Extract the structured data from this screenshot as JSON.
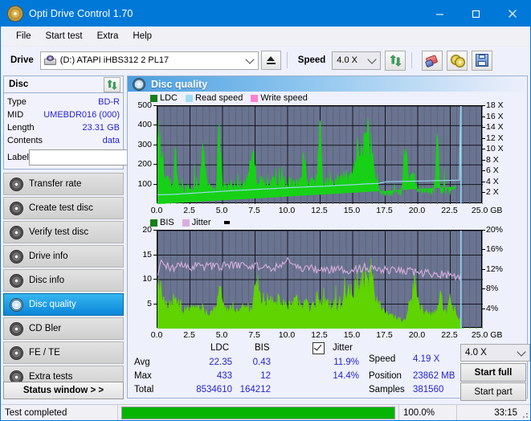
{
  "window": {
    "title": "Opti Drive Control 1.70",
    "icon": "disc-icon",
    "minimize": "–",
    "maximize": "□",
    "close": "✕"
  },
  "menu": [
    "File",
    "Start test",
    "Extra",
    "Help"
  ],
  "toolbar": {
    "drive_label": "Drive",
    "drive_value": "(D:)   ATAPI iHBS312   2 PL17",
    "eject_title": "Eject",
    "speed_label": "Speed",
    "speed_value": "4.0 X",
    "buttons": [
      "refresh-icon",
      "eraser-icon",
      "discs-icon",
      "save-icon"
    ]
  },
  "disc_panel": {
    "title": "Disc",
    "refresh_icon": "refresh-icon",
    "rows": [
      {
        "key": "Type",
        "value": "BD-R"
      },
      {
        "key": "MID",
        "value": "UMEBDR016 (000)"
      },
      {
        "key": "Length",
        "value": "23.31 GB"
      },
      {
        "key": "Contents",
        "value": "data"
      }
    ],
    "label_key": "Label",
    "label_value": "",
    "label_placeholder": ""
  },
  "nav": {
    "items": [
      {
        "label": "Transfer rate",
        "selected": false
      },
      {
        "label": "Create test disc",
        "selected": false
      },
      {
        "label": "Verify test disc",
        "selected": false
      },
      {
        "label": "Drive info",
        "selected": false
      },
      {
        "label": "Disc info",
        "selected": false
      },
      {
        "label": "Disc quality",
        "selected": true
      },
      {
        "label": "CD Bler",
        "selected": false
      },
      {
        "label": "FE / TE",
        "selected": false
      },
      {
        "label": "Extra tests",
        "selected": false
      }
    ],
    "status_window": "Status window > >"
  },
  "panel": {
    "title": "Disc quality",
    "icon": "disc-quality-icon"
  },
  "stats": {
    "col_ldc": "LDC",
    "col_bis": "BIS",
    "col_jitter": "Jitter",
    "row_avg": "Avg",
    "row_max": "Max",
    "row_total": "Total",
    "ldc_avg": "22.35",
    "ldc_max": "433",
    "ldc_total": "8534610",
    "bis_avg": "0.43",
    "bis_max": "12",
    "bis_total": "164212",
    "jitter_checked": true,
    "jitter_avg": "11.9%",
    "jitter_max": "14.4%",
    "speed_label": "Speed",
    "speed_value": "4.19 X",
    "position_label": "Position",
    "position_value": "23862 MB",
    "samples_label": "Samples",
    "samples_value": "381560",
    "speed_select": "4.0 X",
    "start_full": "Start full",
    "start_part": "Start part"
  },
  "statusbar": {
    "message": "Test completed",
    "percent_text": "100.0%",
    "percent_value": 100,
    "elapsed": "33:15"
  },
  "colors": {
    "accent": "#0078d7",
    "ldc_green": "#17d117",
    "bis_green": "#5fd400",
    "read_speed": "#9fdcf5",
    "write_speed": "#ff7fd4",
    "jitter_pink": "#d9aede",
    "plot_bg": "#6a7490",
    "value_blue": "#2424cc",
    "progress_green": "#06b406"
  },
  "chart_data": [
    {
      "type": "area",
      "name": "disc-quality-ldc",
      "title": "",
      "xlabel": "GB",
      "ylabel": "",
      "xlim": [
        0,
        25
      ],
      "ylim": [
        0,
        500
      ],
      "y2lim": [
        0,
        18
      ],
      "xticks": [
        "0.0",
        "2.5",
        "5.0",
        "7.5",
        "10.0",
        "12.5",
        "15.0",
        "17.5",
        "20.0",
        "22.5",
        "25.0"
      ],
      "xtick_suffix": "GB",
      "yticks": [
        100,
        200,
        300,
        400,
        500
      ],
      "y2ticks": [
        "2 X",
        "4 X",
        "6 X",
        "8 X",
        "10 X",
        "12 X",
        "14 X",
        "16 X",
        "18 X"
      ],
      "grid": true,
      "legend": [
        {
          "label": "LDC",
          "color": "#178017"
        },
        {
          "label": "Read speed",
          "color": "#9fdcf5"
        },
        {
          "label": "Write speed",
          "color": "#ff7fd4"
        }
      ],
      "legend_position": "top-left",
      "series": [
        {
          "name": "LDC",
          "color": "#17d117",
          "x": [
            0.0,
            0.12,
            0.25,
            0.37,
            0.5,
            0.62,
            0.75,
            0.87,
            1.0,
            1.12,
            1.25,
            1.37,
            1.5,
            1.62,
            1.75,
            1.87,
            2.0,
            2.25,
            2.5,
            2.75,
            3.0,
            3.25,
            3.5,
            3.75,
            3.85,
            4.0,
            4.25,
            4.5,
            4.75,
            5.0,
            5.15,
            5.3,
            5.5,
            5.75,
            6.0,
            6.25,
            6.5,
            6.75,
            7.0,
            7.25,
            7.5,
            7.6,
            7.75,
            7.9,
            8.0,
            8.25,
            8.5,
            8.75,
            9.0,
            9.25,
            9.5,
            9.75,
            10.0,
            10.25,
            10.5,
            10.75,
            11.0,
            11.25,
            11.5,
            11.75,
            12.0,
            12.25,
            12.5,
            12.6,
            12.7,
            12.9,
            13.0,
            13.25,
            13.5,
            13.75,
            14.0,
            14.25,
            14.5,
            14.75,
            15.0,
            15.25,
            15.5,
            15.7,
            15.85,
            16.0,
            16.15,
            16.3,
            16.5,
            16.75,
            17.0,
            17.25,
            17.5,
            17.75,
            18.0,
            18.25,
            18.5,
            18.75,
            19.0,
            19.25,
            19.5,
            19.7,
            19.85,
            20.0,
            20.25,
            20.5,
            20.75,
            21.0,
            21.25,
            21.5,
            21.75,
            22.0,
            22.25,
            22.5,
            22.6,
            22.75,
            23.0,
            23.2,
            23.3
          ],
          "y": [
            380,
            300,
            310,
            245,
            175,
            140,
            120,
            110,
            105,
            95,
            115,
            320,
            150,
            95,
            80,
            75,
            70,
            75,
            80,
            70,
            75,
            80,
            415,
            130,
            110,
            85,
            80,
            75,
            385,
            95,
            90,
            85,
            95,
            100,
            95,
            90,
            105,
            110,
            120,
            300,
            185,
            130,
            120,
            115,
            110,
            125,
            120,
            115,
            110,
            105,
            115,
            110,
            105,
            110,
            100,
            105,
            110,
            235,
            115,
            110,
            105,
            120,
            435,
            200,
            130,
            120,
            125,
            130,
            120,
            115,
            125,
            130,
            140,
            150,
            170,
            250,
            300,
            320,
            290,
            340,
            380,
            300,
            230,
            150,
            80,
            60,
            55,
            52,
            55,
            60,
            58,
            62,
            310,
            150,
            120,
            130,
            90,
            80,
            75,
            70,
            65,
            62,
            60,
            310,
            75,
            70,
            65,
            60,
            100,
            75,
            120
          ]
        },
        {
          "name": "Read speed",
          "color": "#9fdcf5",
          "axis": "y2",
          "x": [
            0.0,
            1.0,
            2.0,
            3.0,
            4.0,
            5.0,
            6.0,
            7.0,
            8.0,
            9.0,
            10.0,
            11.0,
            12.0,
            13.0,
            14.0,
            15.0,
            16.0,
            17.0,
            17.6,
            18.5,
            19.5,
            20.5,
            21.5,
            22.5,
            23.3,
            23.3
          ],
          "y": [
            1.7,
            1.75,
            1.9,
            2.05,
            2.2,
            2.35,
            2.5,
            2.6,
            2.75,
            2.85,
            3.0,
            3.1,
            3.2,
            3.3,
            3.45,
            3.55,
            3.7,
            3.8,
            4.1,
            4.15,
            4.2,
            4.25,
            4.3,
            4.35,
            4.4,
            18.0
          ]
        }
      ]
    },
    {
      "type": "area",
      "name": "disc-quality-bis-jitter",
      "title": "",
      "xlabel": "GB",
      "ylabel": "",
      "xlim": [
        0,
        25
      ],
      "ylim": [
        0,
        20
      ],
      "y2lim": [
        0,
        20
      ],
      "xticks": [
        "0.0",
        "2.5",
        "5.0",
        "7.5",
        "10.0",
        "12.5",
        "15.0",
        "17.5",
        "20.0",
        "22.5",
        "25.0"
      ],
      "xtick_suffix": "GB",
      "yticks": [
        5,
        10,
        15,
        20
      ],
      "y2ticks": [
        "4%",
        "8%",
        "12%",
        "16%",
        "20%"
      ],
      "grid": true,
      "legend": [
        {
          "label": "BIS",
          "color": "#178017"
        },
        {
          "label": "Jitter",
          "color": "#d9aede"
        }
      ],
      "legend_position": "top-left",
      "series": [
        {
          "name": "BIS",
          "color": "#5fd400",
          "x": [
            0.0,
            0.12,
            0.25,
            0.37,
            0.5,
            0.75,
            1.0,
            1.25,
            1.5,
            1.75,
            2.0,
            2.25,
            2.5,
            2.75,
            3.0,
            3.25,
            3.5,
            3.75,
            4.0,
            4.25,
            4.5,
            4.75,
            5.0,
            5.2,
            5.4,
            5.6,
            5.8,
            6.0,
            6.25,
            6.5,
            6.75,
            7.0,
            7.25,
            7.5,
            7.75,
            8.0,
            8.25,
            8.5,
            8.75,
            9.0,
            9.25,
            9.5,
            9.75,
            10.0,
            10.25,
            10.5,
            10.75,
            11.0,
            11.25,
            11.5,
            11.75,
            12.0,
            12.25,
            12.5,
            12.75,
            13.0,
            13.25,
            13.5,
            13.75,
            14.0,
            14.25,
            14.5,
            14.75,
            15.0,
            15.25,
            15.5,
            15.75,
            15.9,
            16.05,
            16.2,
            16.4,
            16.6,
            16.8,
            17.0,
            17.25,
            17.5,
            17.75,
            18.0,
            18.25,
            18.5,
            18.75,
            19.0,
            19.25,
            19.5,
            19.75,
            20.0,
            20.25,
            20.5,
            20.75,
            21.0,
            21.25,
            21.5,
            21.75,
            22.0,
            22.25,
            22.5,
            22.75,
            23.0,
            23.3
          ],
          "y": [
            11.2,
            9.0,
            8.2,
            7.5,
            5.2,
            4.8,
            4.5,
            6.2,
            5.5,
            4.2,
            4.0,
            3.8,
            3.6,
            4.0,
            3.8,
            4.2,
            4.0,
            3.6,
            3.4,
            3.8,
            3.6,
            9.0,
            4.2,
            4.0,
            3.8,
            4.2,
            4.6,
            4.0,
            3.8,
            4.2,
            4.0,
            4.4,
            5.0,
            8.2,
            6.5,
            7.0,
            5.5,
            6.0,
            5.2,
            4.8,
            5.6,
            5.0,
            4.6,
            5.2,
            4.8,
            5.0,
            6.5,
            4.8,
            4.5,
            5.2,
            4.6,
            4.8,
            7.2,
            5.0,
            4.8,
            5.2,
            4.6,
            5.0,
            4.8,
            5.4,
            5.0,
            6.8,
            7.5,
            7.0,
            8.2,
            9.5,
            10.5,
            9.0,
            11.2,
            9.6,
            10.6,
            8.0,
            7.0,
            5.5,
            3.8,
            3.2,
            2.8,
            2.5,
            2.2,
            2.0,
            1.8,
            1.6,
            4.0,
            5.2,
            9.0,
            5.0,
            3.5,
            3.2,
            3.0,
            2.8,
            3.0,
            3.2,
            6.8,
            3.2,
            3.0,
            7.0,
            3.0,
            2.8,
            1.5
          ]
        },
        {
          "name": "Jitter",
          "color": "#d9aede",
          "x": [
            0.0,
            0.3,
            0.7,
            1.0,
            1.5,
            2.0,
            2.5,
            3.0,
            3.5,
            4.0,
            4.5,
            5.0,
            5.5,
            6.0,
            6.5,
            7.0,
            7.5,
            8.0,
            8.5,
            9.0,
            9.5,
            9.9,
            10.5,
            11.0,
            11.5,
            12.0,
            12.5,
            13.0,
            13.5,
            14.0,
            14.5,
            15.0,
            15.5,
            16.0,
            16.5,
            17.0,
            17.5,
            18.0,
            18.5,
            19.0,
            19.5,
            20.0,
            20.5,
            21.0,
            21.5,
            22.0,
            22.5,
            23.0,
            23.3
          ],
          "y": [
            11.3,
            13.9,
            12.8,
            12.5,
            12.6,
            12.7,
            12.6,
            12.8,
            12.7,
            12.9,
            12.5,
            12.8,
            12.7,
            12.9,
            13.0,
            12.8,
            12.9,
            12.6,
            12.5,
            12.4,
            12.6,
            14.5,
            12.3,
            12.2,
            12.4,
            12.1,
            12.0,
            11.9,
            12.1,
            12.0,
            11.9,
            12.0,
            12.3,
            12.5,
            12.2,
            12.0,
            11.9,
            11.8,
            11.9,
            11.7,
            11.6,
            11.5,
            11.4,
            11.3,
            11.2,
            11.1,
            11.0,
            10.8,
            10.7
          ]
        }
      ]
    }
  ]
}
